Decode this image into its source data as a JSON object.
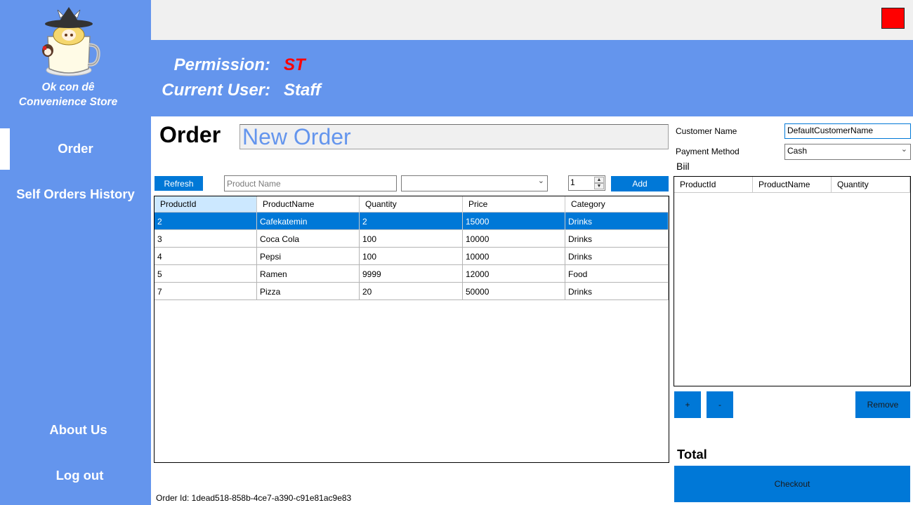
{
  "app": {
    "store_name_line1": "Ok con dê",
    "store_name_line2": "Convenience Store"
  },
  "sidebar": {
    "items": [
      {
        "label": "Order"
      },
      {
        "label": "Self Orders History"
      },
      {
        "label": "About Us"
      },
      {
        "label": "Log out"
      }
    ]
  },
  "header": {
    "permission_label": "Permission:",
    "permission_value": "ST",
    "user_label": "Current User:",
    "user_value": "Staff"
  },
  "order": {
    "title": "Order",
    "name_value": "New Order",
    "refresh_label": "Refresh",
    "product_name_placeholder": "Product Name",
    "category_selected": "",
    "quantity_value": "1",
    "add_label": "Add",
    "order_id_text": "Order Id: 1dead518-858b-4ce7-a390-c91e81ac9e83"
  },
  "products": {
    "columns": [
      "ProductId",
      "ProductName",
      "Quantity",
      "Price",
      "Category"
    ],
    "rows": [
      [
        "2",
        "Cafekatemin",
        "2",
        "15000",
        "Drinks"
      ],
      [
        "3",
        "Coca Cola",
        "100",
        "10000",
        "Drinks"
      ],
      [
        "4",
        "Pepsi",
        "100",
        "10000",
        "Drinks"
      ],
      [
        "5",
        "Ramen",
        "9999",
        "12000",
        "Food"
      ],
      [
        "7",
        "Pizza",
        "20",
        "50000",
        "Drinks"
      ]
    ],
    "selected_row": 0
  },
  "customer": {
    "name_label": "Customer Name",
    "name_value": "DefaultCustomerName",
    "payment_label": "Payment Method",
    "payment_value": "Cash"
  },
  "bill": {
    "label": "Biil",
    "columns": [
      "ProductId",
      "ProductName",
      "Quantity"
    ],
    "plus_label": "+",
    "minus_label": "-",
    "remove_label": "Remove",
    "total_label": "Total",
    "checkout_label": "Checkout"
  },
  "colors": {
    "accent": "#6495ed",
    "button": "#0078d7",
    "close": "#ff0000",
    "permission_value": "#ff0000"
  }
}
